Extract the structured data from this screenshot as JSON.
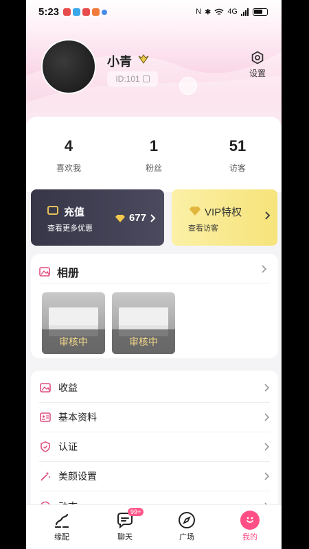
{
  "status": {
    "time": "5:23",
    "signal_text": "4G"
  },
  "profile": {
    "nickname": "小青",
    "id_text": "ID:101",
    "settings_label": "设置"
  },
  "stats": [
    {
      "value": "4",
      "label": "喜欢我"
    },
    {
      "value": "1",
      "label": "粉丝"
    },
    {
      "value": "51",
      "label": "访客"
    }
  ],
  "recharge": {
    "title": "充值",
    "subtitle": "查看更多优惠",
    "coins": "677"
  },
  "vip": {
    "title": "VIP特权",
    "subtitle": "查看访客"
  },
  "album": {
    "title": "相册",
    "items": [
      {
        "status": "审核中"
      },
      {
        "status": "审核中"
      }
    ]
  },
  "menu": [
    {
      "label": "收益",
      "icon": "image-icon"
    },
    {
      "label": "基本资料",
      "icon": "profile-card-icon"
    },
    {
      "label": "认证",
      "icon": "shield-icon"
    },
    {
      "label": "美颜设置",
      "icon": "magic-wand-icon"
    },
    {
      "label": "动态",
      "icon": "moment-icon"
    }
  ],
  "tabs": [
    {
      "label": "缘配"
    },
    {
      "label": "聊天",
      "badge": "99+"
    },
    {
      "label": "广场"
    },
    {
      "label": "我的"
    }
  ],
  "colors": {
    "accent": "#ff4f86",
    "dark_card": "#3c3b4f",
    "vip_card": "#f8e98a"
  }
}
